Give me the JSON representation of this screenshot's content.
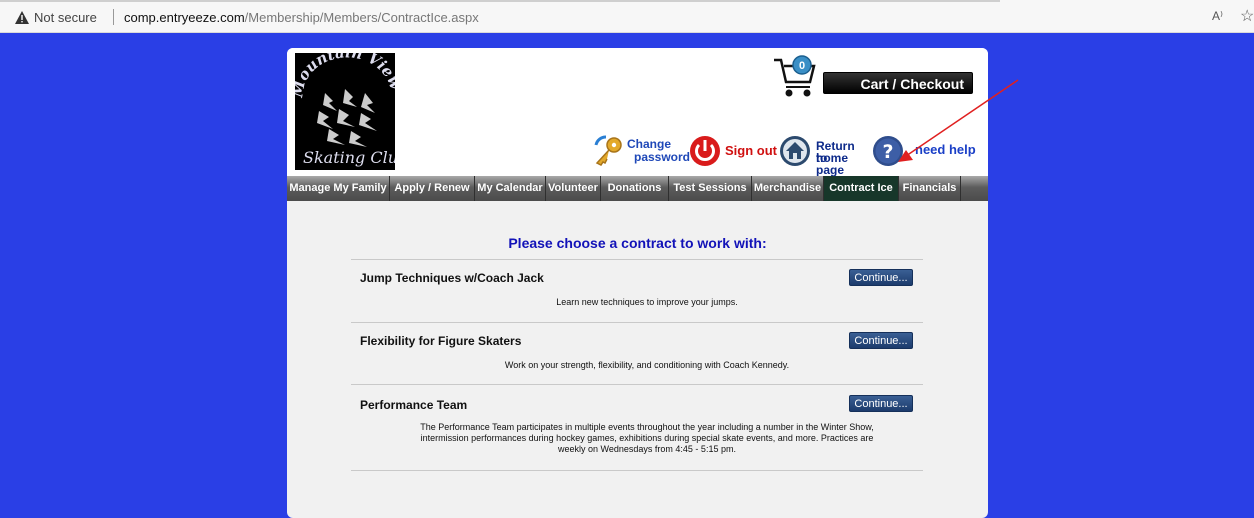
{
  "browser": {
    "security_label": "Not secure",
    "url_host": "comp.entryeeze.com",
    "url_path": "/Membership/Members/ContractIce.aspx",
    "read_aloud_icon": "A⁾"
  },
  "header": {
    "logo_text": "Mountain View",
    "logo_script": "Skating Club",
    "cart_count": "0",
    "cart_label": "Cart / Checkout",
    "change_password": [
      "Change",
      "password"
    ],
    "sign_out": "Sign out",
    "return_home": [
      "Return to",
      "home page"
    ],
    "need_help": "need help"
  },
  "nav": {
    "tabs": [
      {
        "label": "Manage My Family"
      },
      {
        "label": "Apply / Renew"
      },
      {
        "label": "My Calendar"
      },
      {
        "label": "Volunteer"
      },
      {
        "label": "Donations"
      },
      {
        "label": "Test Sessions"
      },
      {
        "label": "Merchandise"
      },
      {
        "label": "Contract Ice"
      },
      {
        "label": "Financials"
      }
    ],
    "active_tab": "Contract Ice"
  },
  "content": {
    "heading": "Please choose a contract to work with:",
    "continue_label": "Continue...",
    "contracts": [
      {
        "title": "Jump Techniques w/Coach Jack",
        "description": "Learn new techniques to improve your jumps."
      },
      {
        "title": "Flexibility for Figure Skaters",
        "description": "Work on your strength, flexibility, and conditioning with Coach Kennedy."
      },
      {
        "title": "Performance Team",
        "description_lines": [
          "The Performance Team participates in multiple events throughout the year including a number in the Winter Show,",
          "intermission performances during hockey games, exhibitions during special skate events, and more. Practices are",
          "weekly on Wednesdays from 4:45 - 5:15 pm."
        ]
      }
    ]
  },
  "colors": {
    "page_background": "#2a3fe6",
    "heading": "#1212b8",
    "active_tab": "#17372a",
    "annotation_arrow": "#e02020"
  }
}
